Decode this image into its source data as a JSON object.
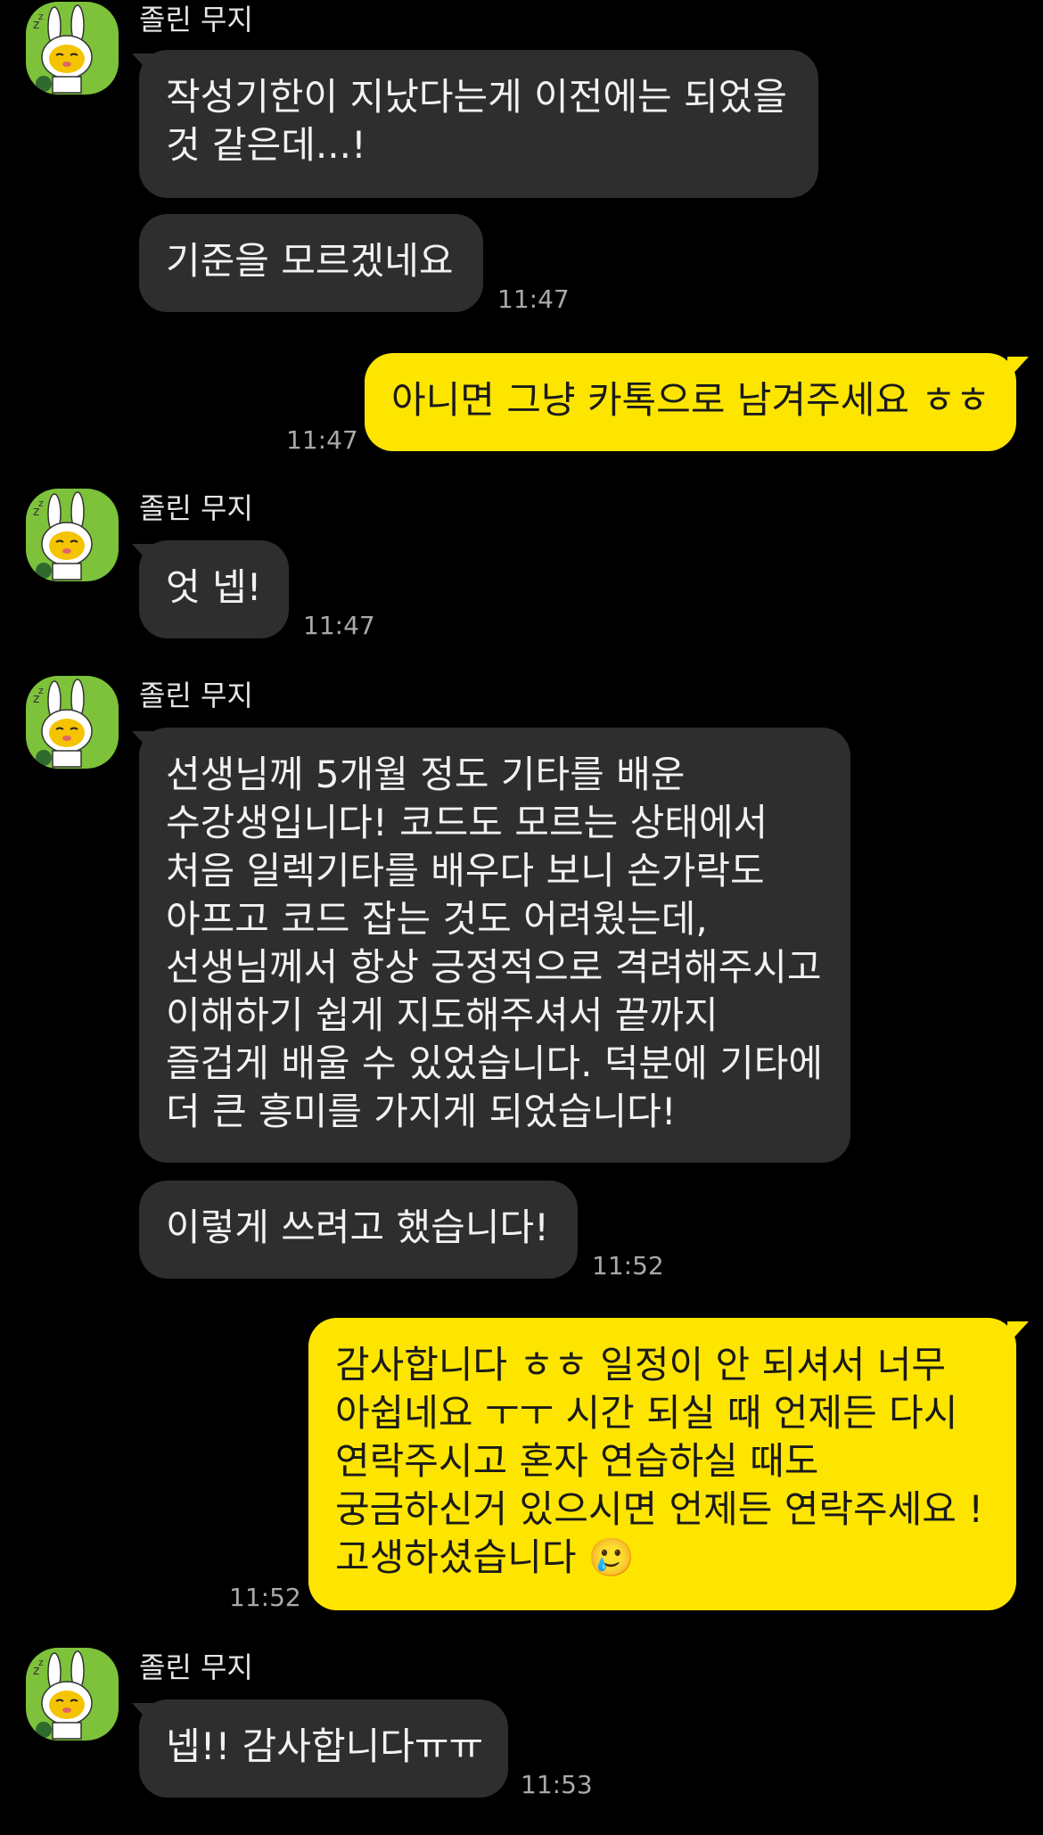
{
  "chat": {
    "sender_name": "졸린 무지",
    "avatar_icon": "sleepy-muzi-icon",
    "colors": {
      "background": "#000000",
      "incoming_bubble": "#2e2e2e",
      "outgoing_bubble": "#fee500",
      "avatar_bg": "#7dc23a"
    },
    "messages": [
      {
        "direction": "in",
        "text": "작성기한이 지났다는게 이전에는 되었을 것 같은데...!"
      },
      {
        "direction": "in",
        "text": "기준을 모르겠네요",
        "time": "11:47"
      },
      {
        "direction": "out",
        "text": "아니면 그냥 카톡으로 남겨주세요 ㅎㅎ",
        "time": "11:47"
      },
      {
        "direction": "in",
        "text": "엇 넵!",
        "time": "11:47"
      },
      {
        "direction": "in",
        "text": "선생님께 5개월 정도 기타를 배운 수강생입니다! 코드도 모르는 상태에서 처음 일렉기타를 배우다 보니 손가락도 아프고 코드 잡는 것도 어려웠는데, 선생님께서 항상 긍정적으로 격려해주시고 이해하기 쉽게 지도해주셔서 끝까지 즐겁게 배울 수 있었습니다. 덕분에 기타에 더 큰 흥미를 가지게 되었습니다!"
      },
      {
        "direction": "in",
        "text": "이렇게 쓰려고 했습니다!",
        "time": "11:52"
      },
      {
        "direction": "out",
        "text": "감사합니다 ㅎㅎ 일정이 안 되셔서 너무 아쉽네요 ㅜㅜ 시간 되실 때 언제든 다시 연락주시고 혼자 연습하실 때도 궁금하신거 있으시면 언제든 연락주세요 ! 고생하셨습니다 🥲",
        "time": "11:52"
      },
      {
        "direction": "in",
        "text": "넵!! 감사합니다ㅠㅠ",
        "time": "11:53"
      }
    ]
  }
}
